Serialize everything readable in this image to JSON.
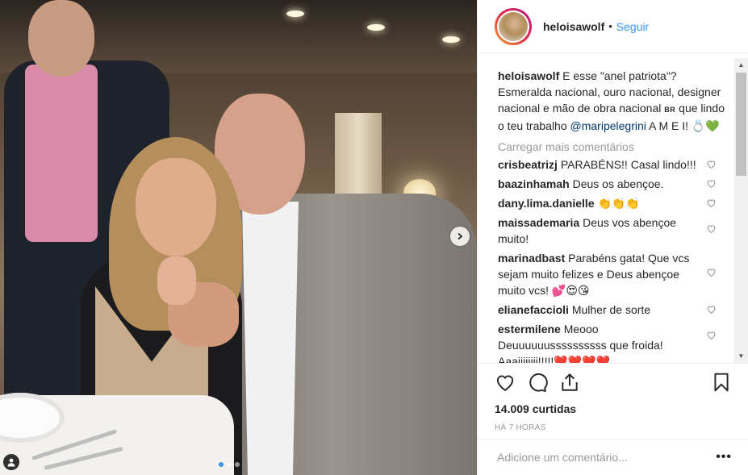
{
  "post": {
    "username": "heloisawolf",
    "separator": "•",
    "follow_label": "Seguir",
    "caption": {
      "username": "heloisawolf",
      "text_1": "E esse \"anel patriota\"? Esmeralda nacional, ouro nacional, designer nacional e mão de obra nacional",
      "flag": "BR",
      "text_2": "que lindo o teu trabalho",
      "mention": "@maripelegrini",
      "text_3": "A M E I!",
      "emoji": "💍💚"
    },
    "load_more": "Carregar mais comentários",
    "comments": [
      {
        "username": "crisbeatrizj",
        "text": "PARABÉNS!! Casal lindo!!!"
      },
      {
        "username": "baazinhamah",
        "text": "Deus os abençoe."
      },
      {
        "username": "dany.lima.danielle",
        "text": "👏👏👏"
      },
      {
        "username": "maissademaria",
        "text": "Deus vos abençoe muito!"
      },
      {
        "username": "marinadbast",
        "text": "Parabéns gata! Que vcs sejam muito felizes e Deus abençoe muito vcs! 💕😍😘"
      },
      {
        "username": "elianefaccioli",
        "text": "Mulher de sorte"
      },
      {
        "username": "estermilene",
        "text": "Meooo Deuuuuuussssssssss que froida! Aaaiiiiiiii!!!!!❤️❤️❤️❤️"
      }
    ],
    "likes": "14.009 curtidas",
    "time": "HÁ 7 HORAS",
    "add_comment_placeholder": "Adicione um comentário...",
    "more_label": "•••"
  },
  "colors": {
    "link": "#3897f0",
    "mention": "#003569",
    "muted": "#999999",
    "text": "#262626",
    "active_dot": "#3897f0"
  },
  "icons": [
    "heart-icon",
    "comment-icon",
    "share-icon",
    "bookmark-icon",
    "user-tag-icon",
    "chevron-right-icon"
  ]
}
